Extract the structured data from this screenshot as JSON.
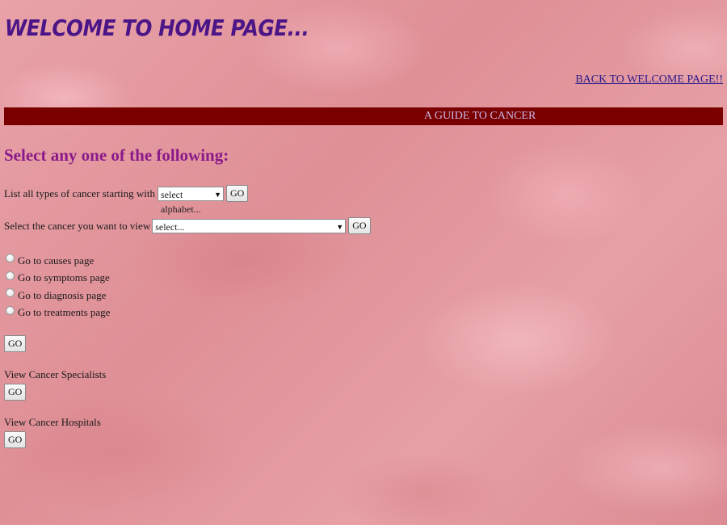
{
  "header": {
    "title": "WELCOME TO HOME PAGE...",
    "back_link": "BACK TO WELCOME PAGE!!"
  },
  "banner": {
    "text": "A GUIDE TO CANCER"
  },
  "main": {
    "heading": "Select any one of the following:",
    "list_by_letter": {
      "label": "List all types of cancer starting with",
      "select_value": "select alphabet...",
      "button": "GO"
    },
    "select_cancer": {
      "label": "Select the cancer you want to view",
      "select_value": "select...",
      "button": "GO"
    },
    "radio_options": [
      "Go to causes page",
      "Go to symptoms page",
      "Go to diagnosis page",
      "Go to treatments page"
    ],
    "radio_go_button": "GO",
    "specialists": {
      "label": "View Cancer Specialists",
      "button": "GO"
    },
    "hospitals": {
      "label": "View Cancer Hospitals",
      "button": "GO"
    }
  },
  "colors": {
    "title": "#4b1487",
    "banner_bg": "#7a0000",
    "banner_text": "#c9b8e6",
    "heading": "#8a1a8a",
    "background": "#e59aa0"
  },
  "icons": {
    "dropdown": "chevron-down-icon"
  }
}
